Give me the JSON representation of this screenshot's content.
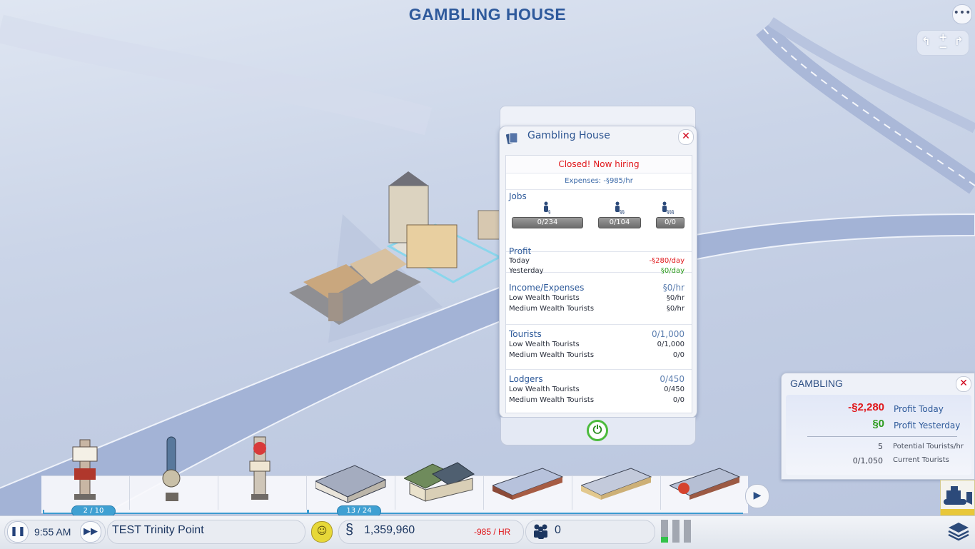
{
  "header": {
    "title": "GAMBLING HOUSE",
    "menu_icon": "ellipsis-icon"
  },
  "camera": {
    "zoom_in": "+",
    "zoom_out": "−"
  },
  "info_panel": {
    "title": "Gambling House",
    "close": "✕",
    "status": "Closed! Now hiring",
    "expenses": "Expenses: -§985/hr",
    "jobs": {
      "label": "Jobs",
      "low": "0/234",
      "medium": "0/104",
      "high": "0/0"
    },
    "profit": {
      "label": "Profit",
      "today_label": "Today",
      "today_value": "-§280/day",
      "yesterday_label": "Yesterday",
      "yesterday_value": "§0/day"
    },
    "income": {
      "label": "Income/Expenses",
      "value": "§0/hr",
      "rows": [
        {
          "label": "Low Wealth Tourists",
          "value": "§0/hr"
        },
        {
          "label": "Medium Wealth Tourists",
          "value": "§0/hr"
        }
      ]
    },
    "tourists": {
      "label": "Tourists",
      "value": "0/1,000",
      "rows": [
        {
          "label": "Low Wealth Tourists",
          "value": "0/1,000"
        },
        {
          "label": "Medium Wealth Tourists",
          "value": "0/0"
        }
      ]
    },
    "lodgers": {
      "label": "Lodgers",
      "value": "0/450",
      "rows": [
        {
          "label": "Low Wealth Tourists",
          "value": "0/450"
        },
        {
          "label": "Medium Wealth Tourists",
          "value": "0/0"
        }
      ]
    },
    "power_icon": "⏻"
  },
  "gambling_panel": {
    "title": "GAMBLING",
    "close": "✕",
    "profit_today_value": "-§2,280",
    "profit_today_label": "Profit Today",
    "profit_yesterday_value": "§0",
    "profit_yesterday_label": "Profit Yesterday",
    "potential_value": "5",
    "potential_label": "Potential Tourists/hr",
    "current_value": "0/1,050",
    "current_label": "Current Tourists"
  },
  "tray": {
    "group1_count": "2 / 10",
    "group2_count": "13 / 24"
  },
  "bottom_bar": {
    "time": "9:55 AM",
    "city_name": "TEST Trinity Point",
    "funds": "1,359,960",
    "rate": "-985 / HR",
    "population": "0"
  },
  "colors": {
    "accent": "#2f5a9c",
    "negative": "#e0161a",
    "positive": "#2a9a1a",
    "counter": "#3fa0d2"
  }
}
